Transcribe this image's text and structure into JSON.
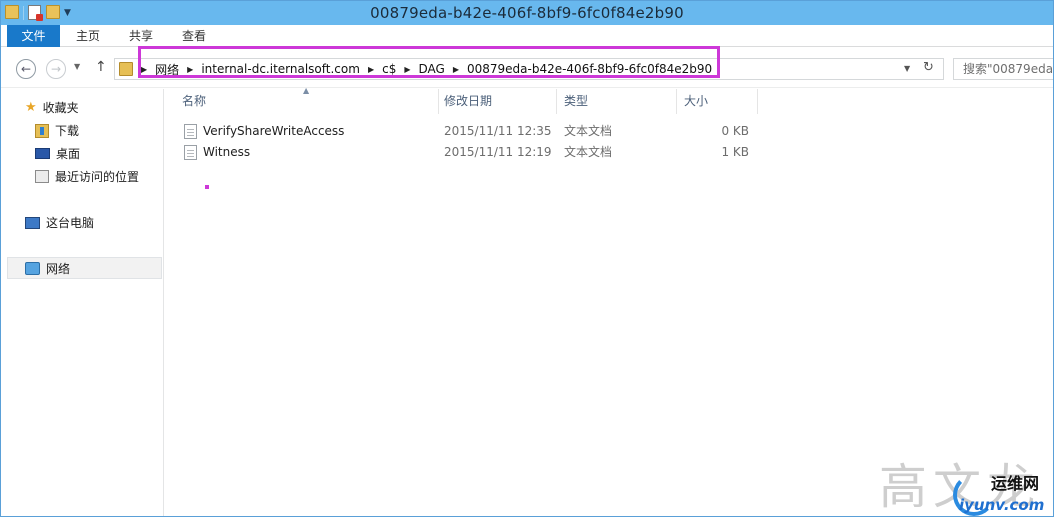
{
  "window": {
    "title": "00879eda-b42e-406f-8bf9-6fc0f84e2b90"
  },
  "ribbon": {
    "tabs": [
      "文件",
      "主页",
      "共享",
      "查看"
    ]
  },
  "address": {
    "crumbs": [
      "网络",
      "internal-dc.iternalsoft.com",
      "c$",
      "DAG",
      "00879eda-b42e-406f-8bf9-6fc0f84e2b90"
    ],
    "search_placeholder": "搜索\"00879eda"
  },
  "navpane": {
    "favorites": "收藏夹",
    "downloads": "下载",
    "desktop": "桌面",
    "recent": "最近访问的位置",
    "this_pc": "这台电脑",
    "network": "网络"
  },
  "columns": {
    "name": "名称",
    "date": "修改日期",
    "type": "类型",
    "size": "大小"
  },
  "files": [
    {
      "name": "VerifyShareWriteAccess",
      "date": "2015/11/11 12:35",
      "type": "文本文档",
      "size": "0 KB"
    },
    {
      "name": "Witness",
      "date": "2015/11/11 12:19",
      "type": "文本文档",
      "size": "1 KB"
    }
  ],
  "watermark": {
    "author": "高文龙",
    "brand": "运维网",
    "site": "iyunv.com"
  },
  "colors": {
    "titlebar": "#68b8ee",
    "file_tab": "#1979ca",
    "highlight": "#cd38d8"
  }
}
